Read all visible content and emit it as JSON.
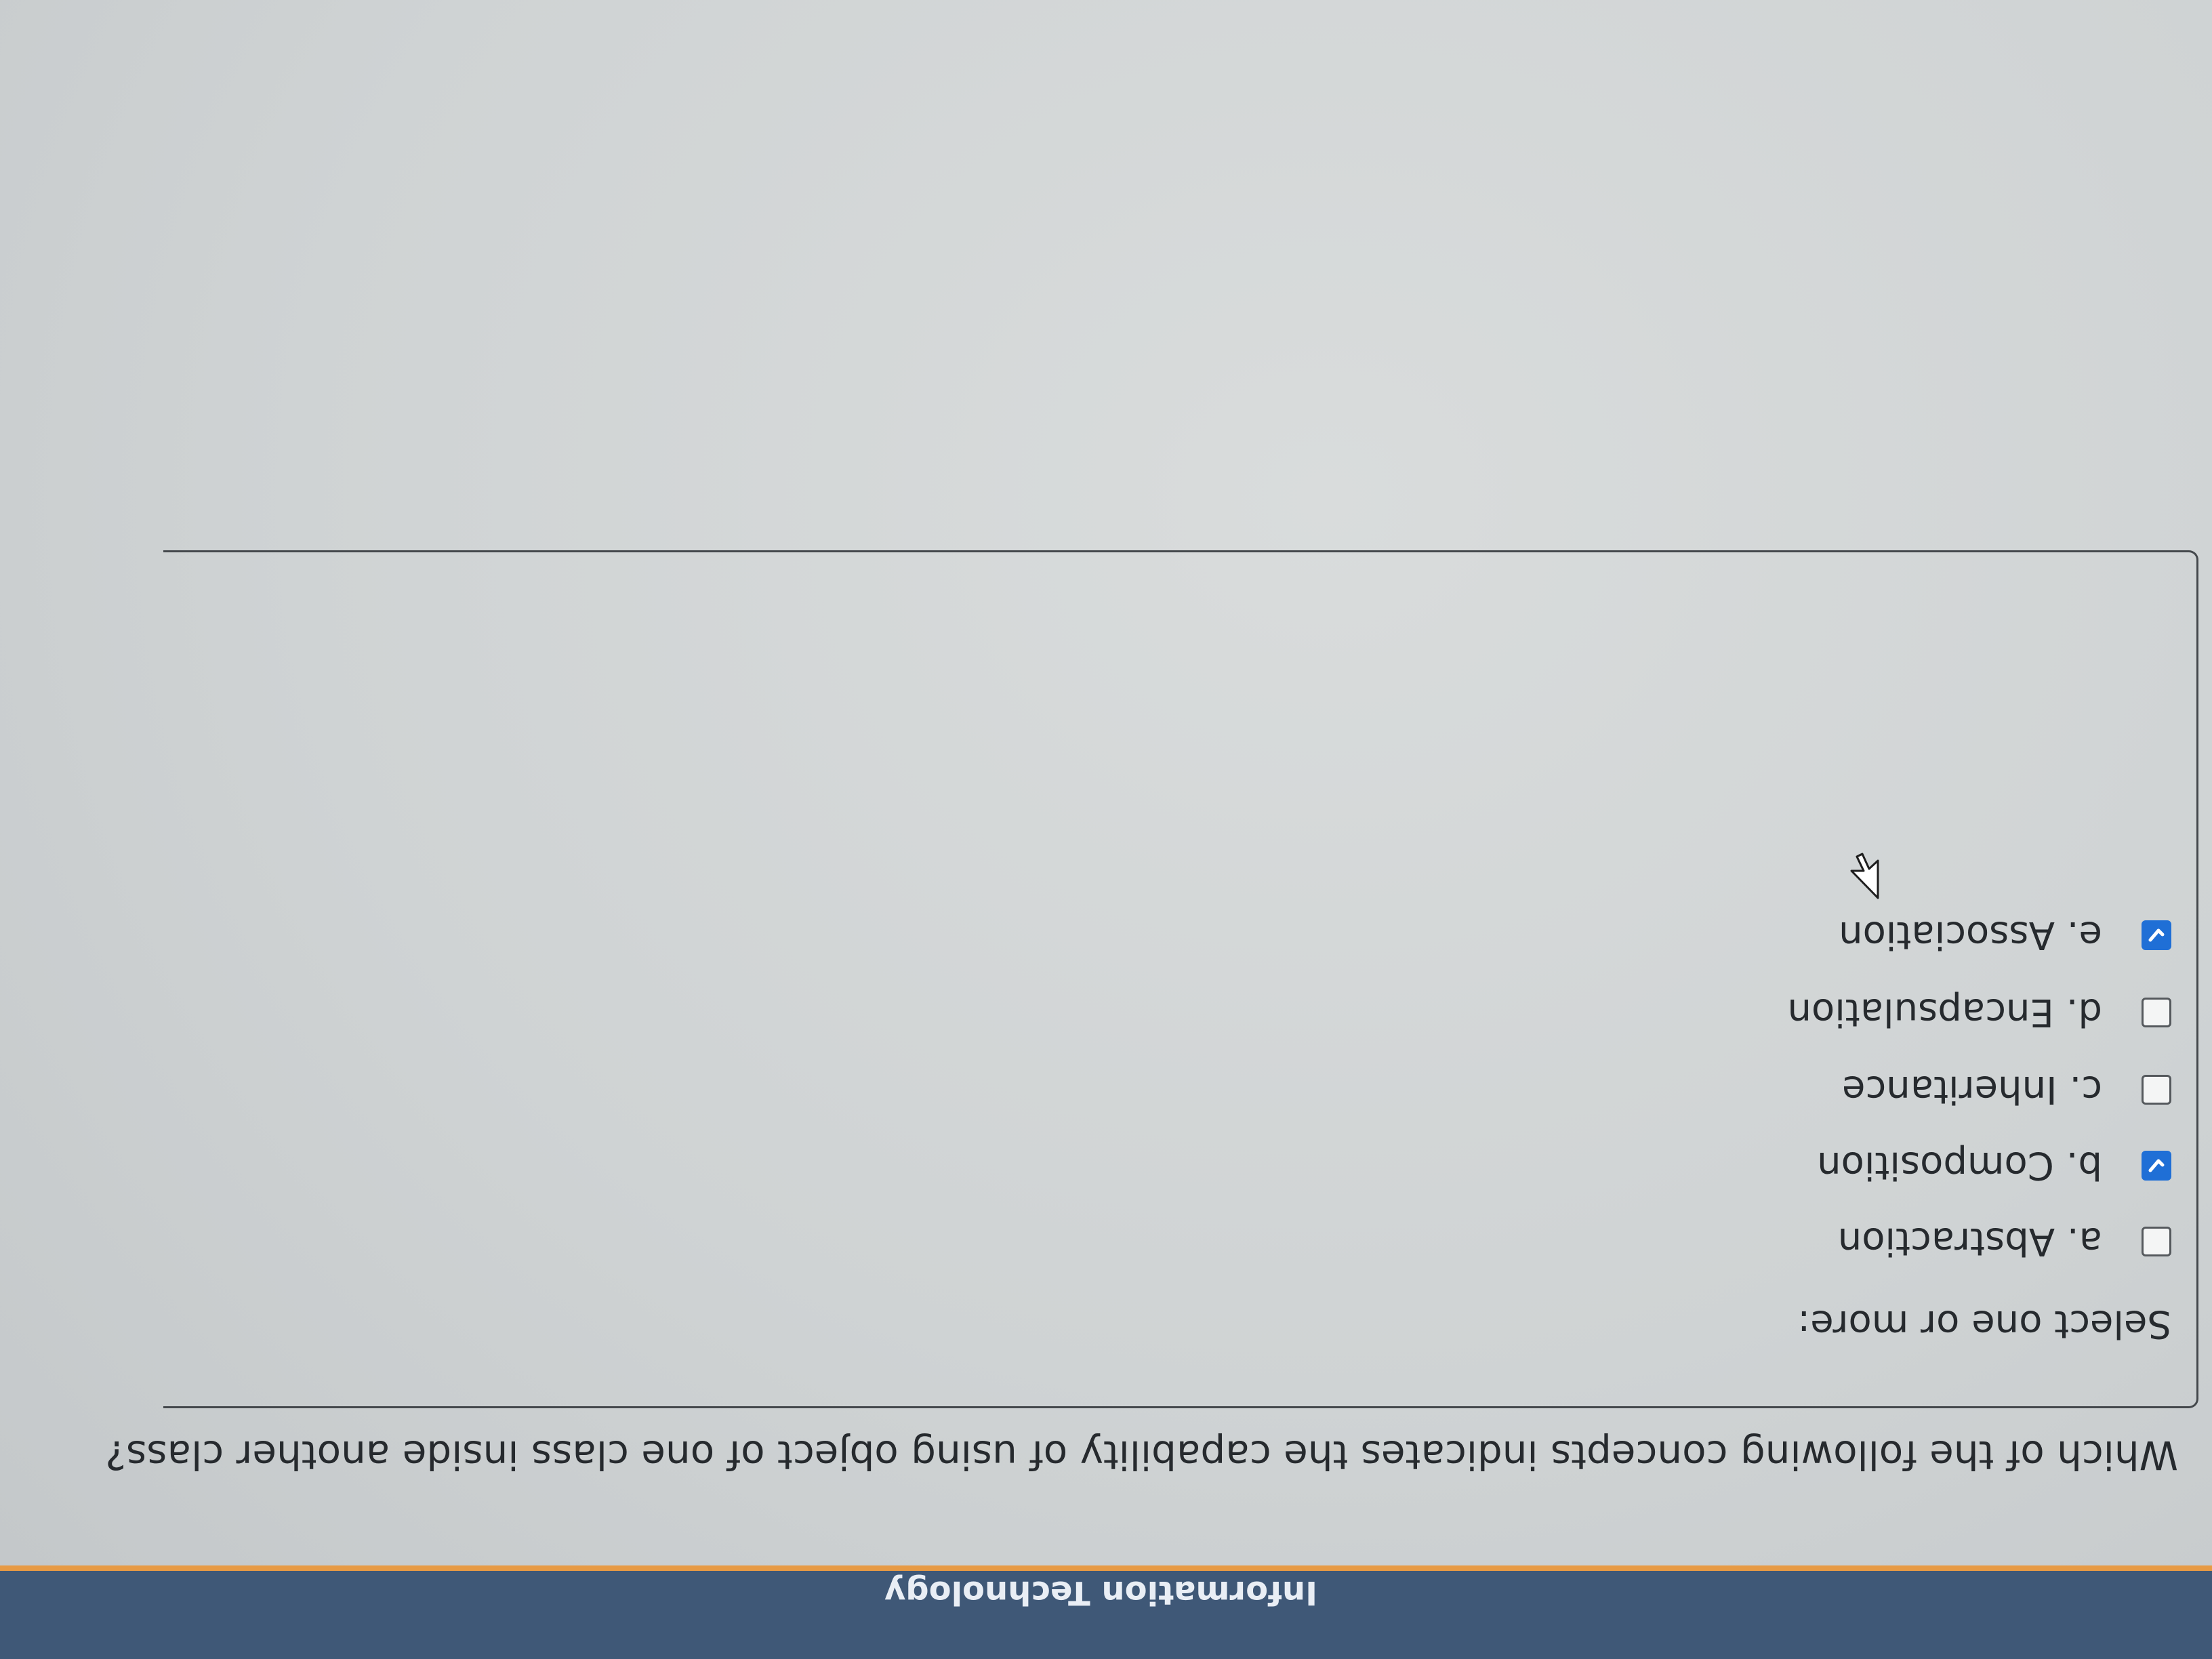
{
  "header": {
    "site_title": "Information Technology",
    "background_color": "#3f5877",
    "accent_color": "#e79a44"
  },
  "question": {
    "text": "Which of the following concepts indicates the capability of using object of one class inside another class?"
  },
  "answer": {
    "prompt": "Select one or more:",
    "options": [
      {
        "label": "a. Abstraction",
        "checked": false
      },
      {
        "label": "b. Composition",
        "checked": true
      },
      {
        "label": "c. Inheritance",
        "checked": false
      },
      {
        "label": "d. Encapsulation",
        "checked": false
      },
      {
        "label": "e. Association",
        "checked": true
      }
    ],
    "checked_color": "#1f6fd6"
  },
  "icons": {
    "checkmark": "check-icon",
    "cursor": "mouse-pointer-icon"
  }
}
